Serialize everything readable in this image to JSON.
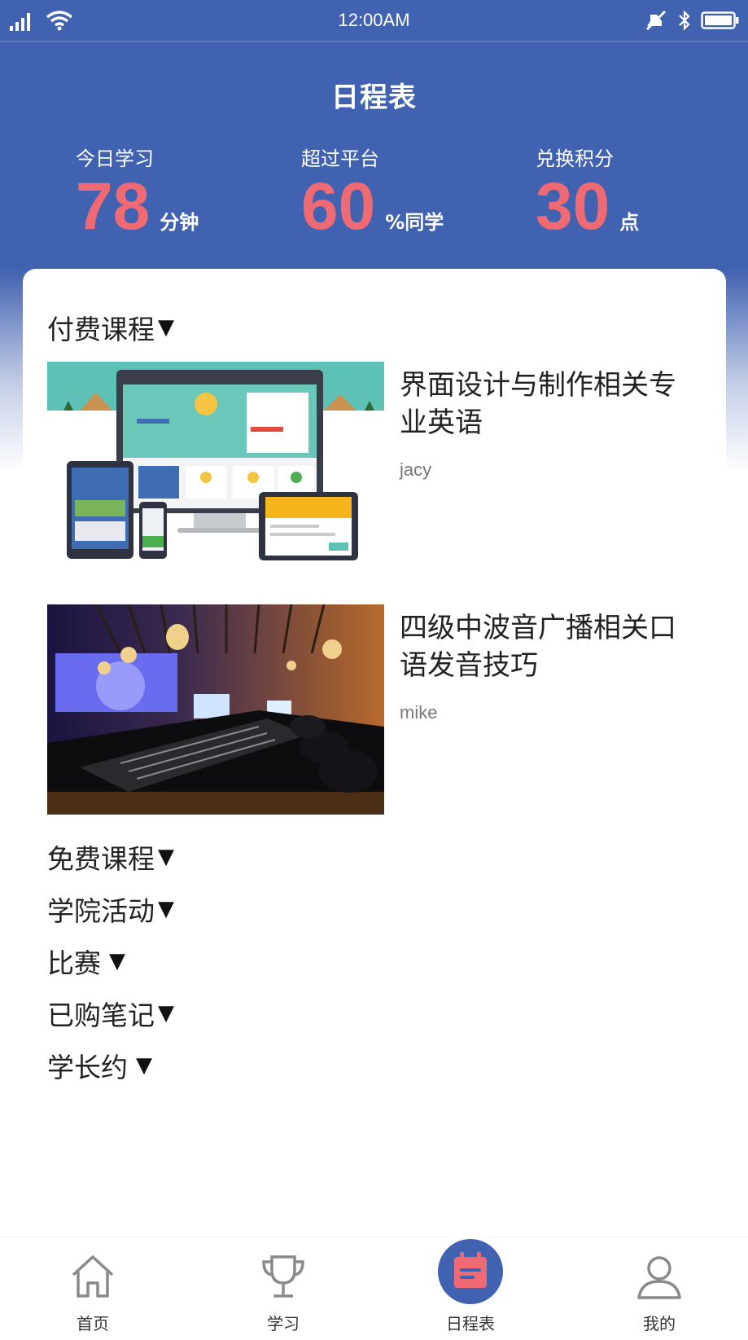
{
  "status_bar": {
    "time": "12:00AM"
  },
  "header": {
    "title": "日程表",
    "stats": [
      {
        "label": "今日学习",
        "value": "78",
        "unit": "分钟"
      },
      {
        "label": "超过平台",
        "value": "60",
        "unit": "%同学"
      },
      {
        "label": "兑换积分",
        "value": "30",
        "unit": "点"
      }
    ]
  },
  "colors": {
    "primary": "#4162b0",
    "accent": "#ef6a72"
  },
  "sections": {
    "paid": "付费课程",
    "free": "免费课程",
    "activities": "学院活动",
    "contest": "比赛",
    "notes": "已购笔记",
    "senior": "学长约",
    "arrow": "▼"
  },
  "courses": [
    {
      "title": "界面设计与制作相关专业英语",
      "author": "jacy"
    },
    {
      "title": "四级中波音广播相关口语发音技巧",
      "author": "mike"
    }
  ],
  "nav": [
    {
      "label": "首页",
      "icon": "home-icon"
    },
    {
      "label": "学习",
      "icon": "trophy-icon"
    },
    {
      "label": "日程表",
      "icon": "calendar-icon",
      "active": true
    },
    {
      "label": "我的",
      "icon": "user-icon"
    }
  ]
}
